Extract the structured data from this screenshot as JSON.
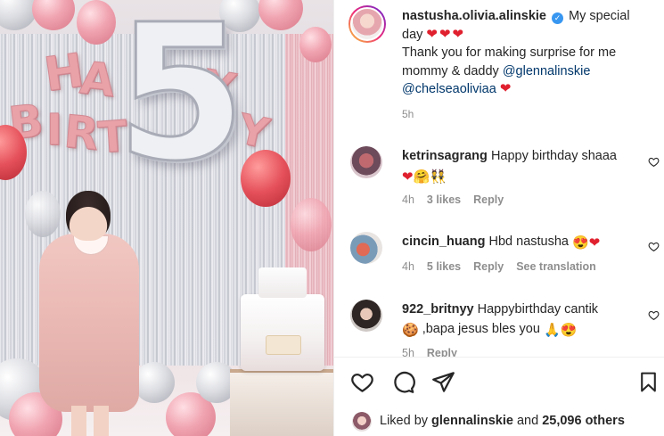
{
  "post": {
    "author": "nastusha.olivia.alinskie",
    "caption_line1": "My special",
    "caption_line2": "day",
    "caption_hearts": "❤❤❤",
    "caption_body": "Thank you for making surprise for me mommy & daddy",
    "mention1": "@glennalinskie",
    "mention2": "@chelseaoliviaa",
    "caption_end_heart": "❤",
    "time": "5h"
  },
  "comments": [
    {
      "user": "ketrinsagrang",
      "text": "Happy birthday shaaa",
      "emojis": "❤🤗👯",
      "time": "4h",
      "likes": "3 likes",
      "reply": "Reply"
    },
    {
      "user": "cincin_huang",
      "text": "Hbd nastusha",
      "emojis": "😍❤",
      "time": "4h",
      "likes": "5 likes",
      "reply": "Reply",
      "translate": "See translation"
    },
    {
      "user": "922_britnyy",
      "text": "Happybirthday cantik",
      "line2_prefix": "🍪",
      "line2": ",bapa jesus bles you",
      "line2_emojis": "🙏😍",
      "time": "5h",
      "reply": "Reply"
    }
  ],
  "footer": {
    "liked_by_prefix": "Liked by",
    "liked_by_user": "glennalinskie",
    "and_word": "and",
    "others": "25,096 others"
  },
  "icons": {
    "like": "heart-outline-icon",
    "comment": "comment-bubble-icon",
    "share": "paper-plane-icon",
    "save": "bookmark-icon",
    "verified": "verified-badge-icon"
  },
  "colors": {
    "mention": "#00376b",
    "muted": "#8e8e8e",
    "heart_red": "#e0202e",
    "verified_blue": "#3897f0"
  }
}
